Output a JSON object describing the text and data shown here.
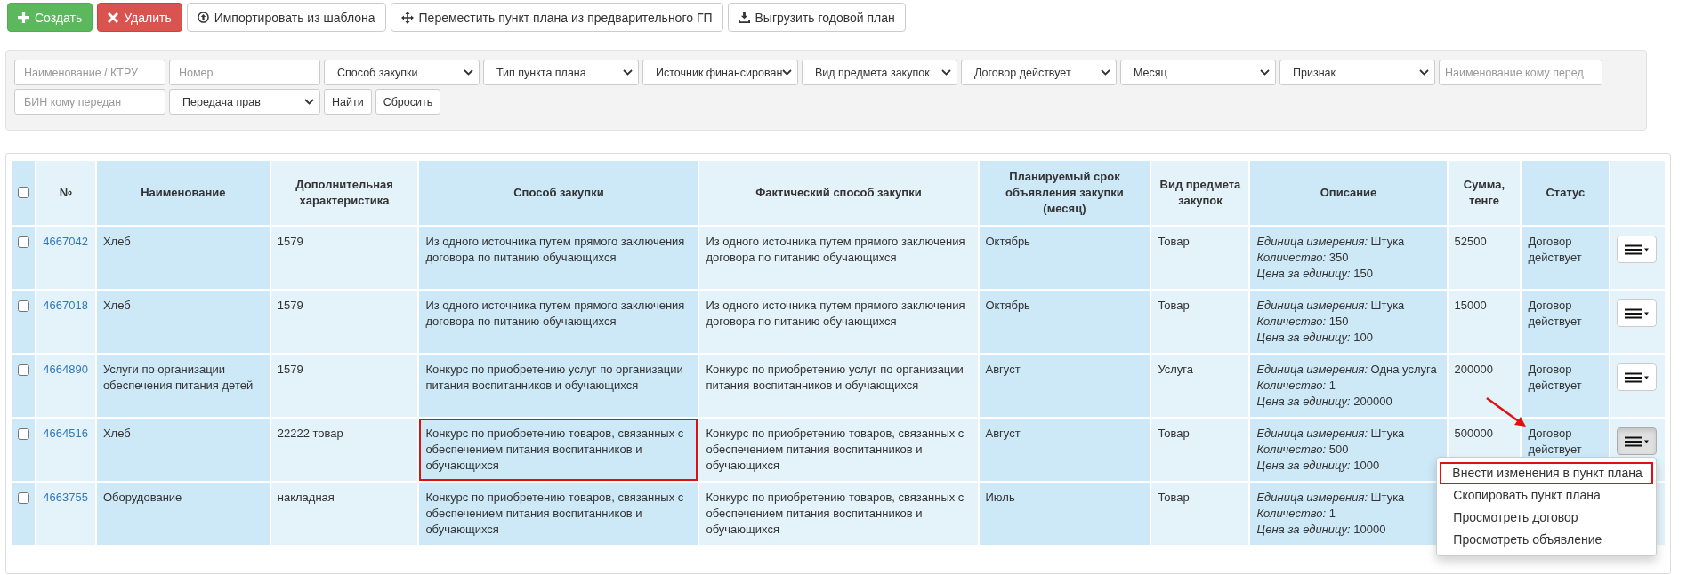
{
  "toolbar": [
    {
      "kind": "create",
      "label": "Создать"
    },
    {
      "kind": "delete",
      "label": "Удалить"
    },
    {
      "kind": "import",
      "label": "Импортировать из шаблона"
    },
    {
      "kind": "move",
      "label": "Переместить пункт плана из предварительного ГП"
    },
    {
      "kind": "download",
      "label": "Выгрузить годовой план"
    }
  ],
  "filters": [
    {
      "kind": "input",
      "placeholder": "Наименование / КТРУ"
    },
    {
      "kind": "input",
      "placeholder": "Номер"
    },
    {
      "kind": "select",
      "value": "Способ закупки"
    },
    {
      "kind": "select",
      "value": "Тип пункта плана"
    },
    {
      "kind": "select",
      "value": "Источник финансирован"
    },
    {
      "kind": "select",
      "value": "Вид предмета закупок"
    },
    {
      "kind": "select",
      "value": "Договор действует"
    },
    {
      "kind": "select",
      "value": "Месяц"
    },
    {
      "kind": "select",
      "value": "Признак"
    },
    {
      "kind": "input",
      "placeholder": "Наименование кому перед"
    },
    {
      "kind": "input",
      "placeholder": "БИН кому передан"
    },
    {
      "kind": "select",
      "value": "Передача прав"
    },
    {
      "kind": "button",
      "label": "Найти"
    },
    {
      "kind": "button",
      "label": "Сбросить"
    }
  ],
  "table": {
    "header_checkbox": {
      "checked": false
    },
    "columns": [
      "№",
      "Наименование",
      "Дополнительная характеристика",
      "Способ закупки",
      "Фактический способ закупки",
      "Планируемый срок объявления закупки (месяц)",
      "Вид предмета закупок",
      "Описание",
      "Сумма, тенге",
      "Статус"
    ],
    "rows": [
      {
        "checked": false,
        "number": "4667042",
        "name": "Хлеб",
        "extra": "1579",
        "method": "Из одного источника путем прямого заключения договора по питанию обучающихся",
        "method_highlighted": false,
        "actual_method": "Из одного источника путем прямого заключения договора по питанию обучающихся",
        "month": "Октябрь",
        "subject_type": "Товар",
        "description": [
          "*Единица измерения:* Штука",
          "*Количество:* 350",
          "*Цена за единицу:* 150"
        ],
        "sum": "52500",
        "status": "Договор действует",
        "status_arrow": false,
        "menu_open": false
      },
      {
        "checked": false,
        "number": "4667018",
        "name": "Хлеб",
        "extra": "1579",
        "method": "Из одного источника путем прямого заключения договора по питанию обучающихся",
        "method_highlighted": false,
        "actual_method": "Из одного источника путем прямого заключения договора по питанию обучающихся",
        "month": "Октябрь",
        "subject_type": "Товар",
        "description": [
          "*Единица измерения:* Штука",
          "*Количество:* 150",
          "*Цена за единицу:* 100"
        ],
        "sum": "15000",
        "status": "Договор действует",
        "status_arrow": false,
        "menu_open": false
      },
      {
        "checked": false,
        "number": "4664890",
        "name": "Услуги по организации обеспечения питания детей",
        "extra": "1579",
        "method": "Конкурс по приобретению услуг по организации питания воспитанников и обучающихся",
        "method_highlighted": false,
        "actual_method": "Конкурс по приобретению услуг по организации питания воспитанников и обучающихся",
        "month": "Август",
        "subject_type": "Услуга",
        "description": [
          "*Единица измерения:* Одна услуга",
          "*Количество:* 1",
          "*Цена за единицу:* 200000"
        ],
        "sum": "200000",
        "status": "Договор действует",
        "status_arrow": false,
        "menu_open": false
      },
      {
        "checked": false,
        "number": "4664516",
        "name": "Хлеб",
        "extra": "22222 товар",
        "method": "Конкурс по приобретению товаров, связанных с обеспечением питания воспитанников и обучающихся",
        "method_highlighted": true,
        "actual_method": "Конкурс по приобретению товаров, связанных с обеспечением питания воспитанников и обучающихся",
        "month": "Август",
        "subject_type": "Товар",
        "description": [
          "*Единица измерения:* Штука",
          "*Количество:* 500",
          "*Цена за единицу:* 1000"
        ],
        "sum": "500000",
        "status": "Договор действует",
        "status_arrow": true,
        "menu_open": true
      },
      {
        "checked": false,
        "number": "4663755",
        "name": "Оборудование",
        "extra": "накладная",
        "method": "Конкурс по приобретению товаров, связанных с обеспечением питания воспитанников и обучающихся",
        "method_highlighted": false,
        "actual_method": "Конкурс по приобретению товаров, связанных с обеспечением питания воспитанников и обучающихся",
        "month": "Июль",
        "subject_type": "Товар",
        "description": [
          "*Единица измерения:* Штука",
          "*Количество:* 1",
          "*Цена за единицу:* 10000"
        ],
        "status_arrow": false
      }
    ]
  },
  "row_menu": {
    "items": [
      {
        "label": "Внести изменения в пункт плана",
        "highlighted": true
      },
      {
        "label": "Скопировать пункт плана",
        "highlighted": false
      },
      {
        "label": "Просмотреть договор",
        "highlighted": false
      },
      {
        "label": "Просмотреть объявление",
        "highlighted": false
      }
    ]
  }
}
